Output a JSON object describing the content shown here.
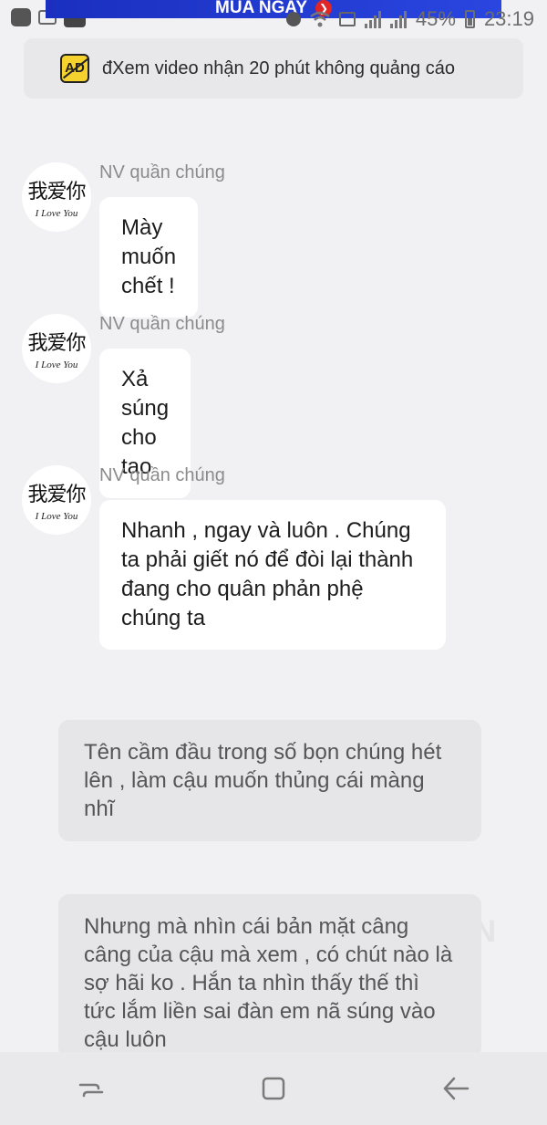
{
  "status_bar": {
    "banner_text": "MUA NGAY",
    "battery": "45%",
    "time": "23:19"
  },
  "ad": {
    "icon_text": "AD",
    "text": "đXem video nhận 20 phút không quảng cáo"
  },
  "avatar": {
    "chinese": "我爱你",
    "english": "I Love You"
  },
  "messages": [
    {
      "sender": "NV quần chúng",
      "text": "Mày muốn chết !"
    },
    {
      "sender": "NV quần chúng",
      "text": "Xả súng cho tao"
    },
    {
      "sender": "NV quần chúng",
      "text": "Nhanh , ngay và luôn . Chúng ta phải giết nó để đòi lại thành đang cho quân phản phệ chúng ta"
    }
  ],
  "narrations": [
    {
      "text": "Tên cầm đầu trong số bọn chúng hét lên , làm cậu muốn thủng cái màng nhĩ"
    },
    {
      "text": "Nhưng mà nhìn cái bản mặt câng câng của cậu mà xem , có chút nào là sợ hãi ko . Hắn ta nhìn thấy thế thì tức lắm liền sai đàn em nã súng vào cậu luôn"
    }
  ],
  "watermark": "ON",
  "nav": {
    "recents_icon": "recents-icon",
    "home_icon": "home-icon",
    "back_icon": "back-icon"
  }
}
